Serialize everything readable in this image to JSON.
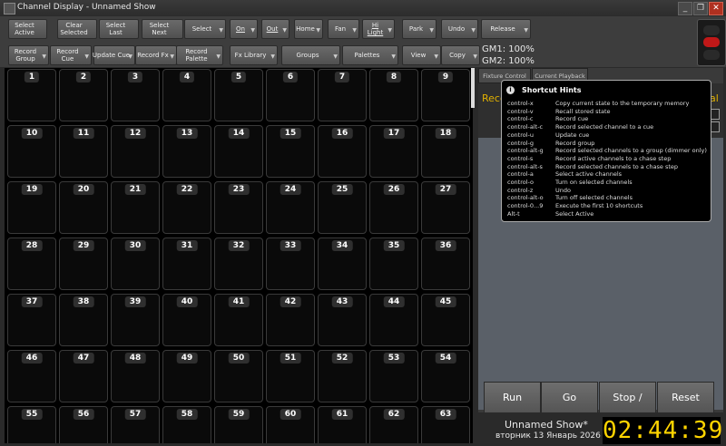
{
  "window": {
    "title": "Channel Display - Unnamed Show",
    "minimize": "_",
    "restore": "❐",
    "close": "✕"
  },
  "toolbar": {
    "row1": [
      {
        "label": "Select\nActive",
        "dropdown": false
      },
      {
        "label": "Clear\nSelected",
        "dropdown": false
      },
      {
        "label": "Select\nLast",
        "dropdown": false
      },
      {
        "label": "Select\nNext",
        "dropdown": false
      },
      {
        "label": "Select",
        "dropdown": true
      },
      {
        "label": "On",
        "dropdown": true,
        "underline": true
      },
      {
        "label": "Out",
        "dropdown": true,
        "underline": true
      },
      {
        "label": "Home",
        "dropdown": true
      },
      {
        "label": "Fan",
        "dropdown": true
      },
      {
        "label": "Hi\nLight",
        "dropdown": true,
        "underline": true
      },
      {
        "label": "Park",
        "dropdown": true
      },
      {
        "label": "Undo",
        "dropdown": true
      },
      {
        "label": "Release",
        "dropdown": true
      }
    ],
    "row2": [
      {
        "label": "Record\nGroup",
        "dropdown": true
      },
      {
        "label": "Record\nCue",
        "dropdown": true
      },
      {
        "label": "Update Cue",
        "dropdown": true
      },
      {
        "label": "Record Fx",
        "dropdown": true
      },
      {
        "label": "Record\nPalette",
        "dropdown": true
      },
      {
        "label": "Fx Library",
        "dropdown": true
      },
      {
        "label": "Groups",
        "dropdown": true
      },
      {
        "label": "Palettes",
        "dropdown": true
      },
      {
        "label": "View",
        "dropdown": true
      },
      {
        "label": "Copy",
        "dropdown": true
      }
    ],
    "gm1": "GM1: 100%",
    "gm2": "GM2: 100%"
  },
  "channels": [
    "1",
    "2",
    "3",
    "4",
    "5",
    "6",
    "7",
    "8",
    "9",
    "10",
    "11",
    "12",
    "13",
    "14",
    "15",
    "16",
    "17",
    "18",
    "19",
    "20",
    "21",
    "22",
    "23",
    "24",
    "25",
    "26",
    "27",
    "28",
    "29",
    "30",
    "31",
    "32",
    "33",
    "34",
    "35",
    "36",
    "37",
    "38",
    "39",
    "40",
    "41",
    "42",
    "43",
    "44",
    "45",
    "46",
    "47",
    "48",
    "49",
    "50",
    "51",
    "52",
    "53",
    "54",
    "55",
    "56",
    "57",
    "58",
    "59",
    "60",
    "61",
    "62",
    "63"
  ],
  "right_panel": {
    "tabs": [
      "Fixture Control",
      "Current Playback"
    ],
    "overlap_left": "Record",
    "overlap_right": "al"
  },
  "hints": {
    "title": "Shortcut Hints",
    "rows": [
      {
        "key": "control-x",
        "desc": "Copy current state to the temporary memory"
      },
      {
        "key": "control-v",
        "desc": "Recall stored state"
      },
      {
        "key": "control-c",
        "desc": "Record cue"
      },
      {
        "key": "control-alt-c",
        "desc": "Record selected channel to a cue"
      },
      {
        "key": "control-u",
        "desc": "Update cue"
      },
      {
        "key": "control-g",
        "desc": "Record group"
      },
      {
        "key": "control-alt-g",
        "desc": "Record selected channels to a group (dimmer only)"
      },
      {
        "key": "control-s",
        "desc": "Record active channels to a chase step"
      },
      {
        "key": "control-alt-s",
        "desc": "Record selected channels to a chase step"
      },
      {
        "key": "control-a",
        "desc": "Select active channels"
      },
      {
        "key": "control-o",
        "desc": "Turn on selected channels"
      },
      {
        "key": "control-z",
        "desc": "Undo"
      },
      {
        "key": "control-alt-o",
        "desc": "Turn off selected channels"
      },
      {
        "key": "control-0...9",
        "desc": "Execute the first 10 shortcuts"
      },
      {
        "key": "Alt-t",
        "desc": "Select Active"
      }
    ]
  },
  "playback": {
    "run": "Run",
    "go": "Go",
    "stop_back": "Stop / Back",
    "reset": "Reset"
  },
  "footer": {
    "show": "Unnamed Show*",
    "date": "вторник 13 Январь  2026",
    "clock": "02:44:39"
  },
  "colors": {
    "clock": "#ffd400",
    "accent": "#e0b000"
  }
}
